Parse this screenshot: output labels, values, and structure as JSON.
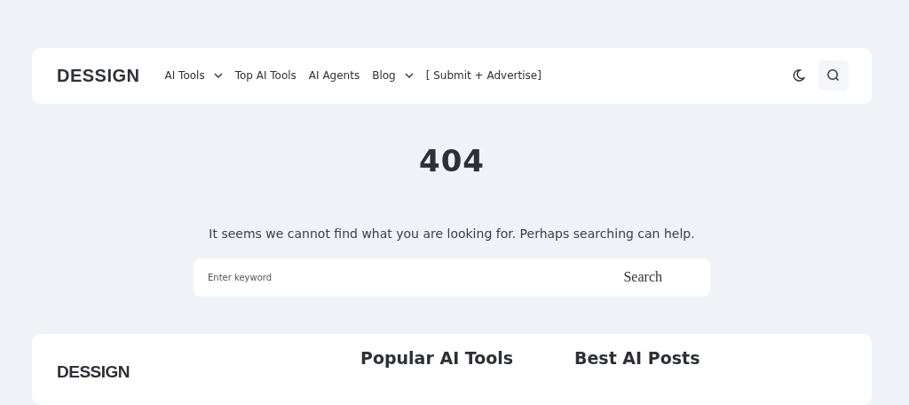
{
  "header": {
    "logo": "DESSIGN",
    "nav": [
      {
        "label": "AI Tools",
        "dropdown": true
      },
      {
        "label": "Top AI Tools",
        "dropdown": false
      },
      {
        "label": "AI Agents",
        "dropdown": false
      },
      {
        "label": "Blog",
        "dropdown": true
      },
      {
        "label": "[ Submit + Advertise]",
        "dropdown": false
      }
    ]
  },
  "error": {
    "code": "404",
    "message": "It seems we cannot find what you are looking for. Perhaps searching can help."
  },
  "search": {
    "placeholder": "Enter keyword",
    "button": "Search"
  },
  "footer": {
    "logo": "DESSIGN",
    "headings": [
      "Popular AI Tools",
      "Best AI Posts"
    ]
  }
}
